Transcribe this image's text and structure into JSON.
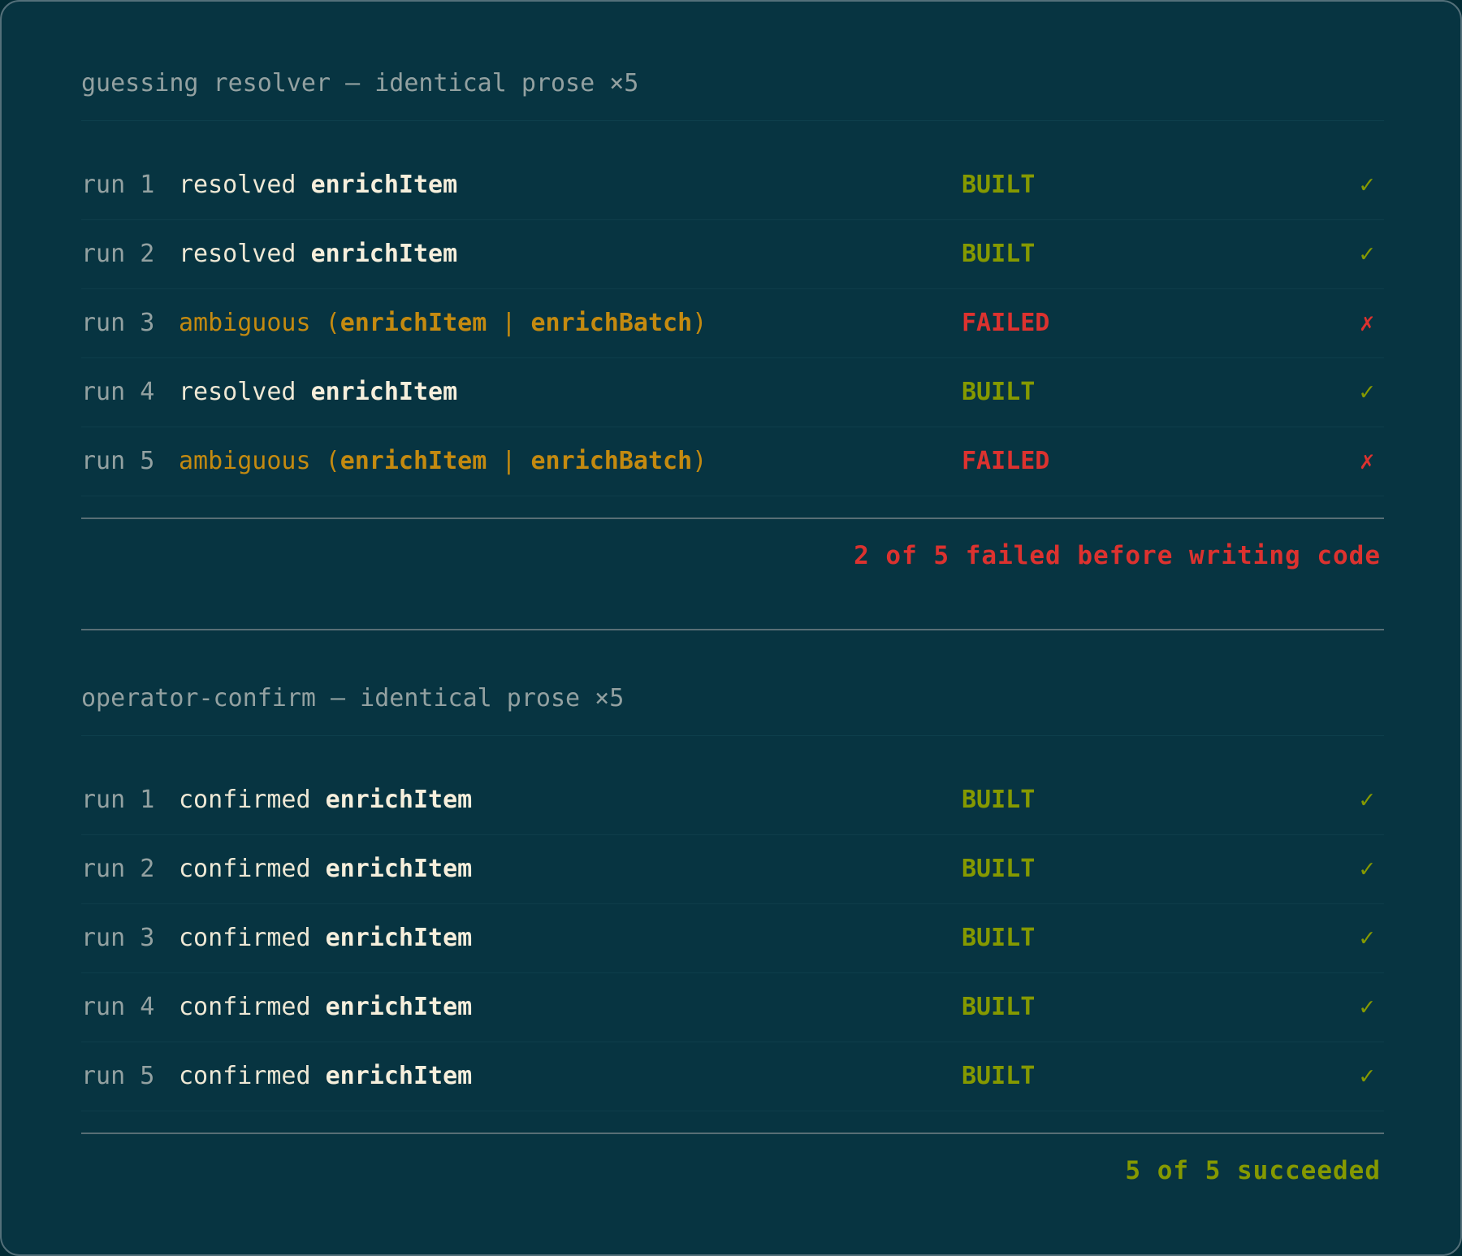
{
  "section1": {
    "heading": "guessing resolver — identical prose ×5",
    "rows": [
      {
        "run": "run 1",
        "verb": "resolved",
        "target": "enrichItem",
        "status": "BUILT",
        "mark": "✓"
      },
      {
        "run": "run 2",
        "verb": "resolved",
        "target": "enrichItem",
        "status": "BUILT",
        "mark": "✓"
      },
      {
        "run": "run 3",
        "verb": "ambiguous (",
        "target": "enrichItem",
        "sep": " | ",
        "target2": "enrichBatch",
        "close": ")",
        "status": "FAILED",
        "mark": "✗"
      },
      {
        "run": "run 4",
        "verb": "resolved",
        "target": "enrichItem",
        "status": "BUILT",
        "mark": "✓"
      },
      {
        "run": "run 5",
        "verb": "ambiguous (",
        "target": "enrichItem",
        "sep": " | ",
        "target2": "enrichBatch",
        "close": ")",
        "status": "FAILED",
        "mark": "✗"
      }
    ],
    "summary": "2 of 5 failed before writing code"
  },
  "section2": {
    "heading": "operator-confirm — identical prose ×5",
    "rows": [
      {
        "run": "run 1",
        "verb": "confirmed",
        "target": "enrichItem",
        "status": "BUILT",
        "mark": "✓"
      },
      {
        "run": "run 2",
        "verb": "confirmed",
        "target": "enrichItem",
        "status": "BUILT",
        "mark": "✓"
      },
      {
        "run": "run 3",
        "verb": "confirmed",
        "target": "enrichItem",
        "status": "BUILT",
        "mark": "✓"
      },
      {
        "run": "run 4",
        "verb": "confirmed",
        "target": "enrichItem",
        "status": "BUILT",
        "mark": "✓"
      },
      {
        "run": "run 5",
        "verb": "confirmed",
        "target": "enrichItem",
        "status": "BUILT",
        "mark": "✓"
      }
    ],
    "summary": "5 of 5 succeeded"
  },
  "colors": {
    "background": "#073441",
    "success": "#859900",
    "failure": "#dc322f",
    "ambiguous": "#c48a10",
    "muted": "#93a1a1"
  }
}
